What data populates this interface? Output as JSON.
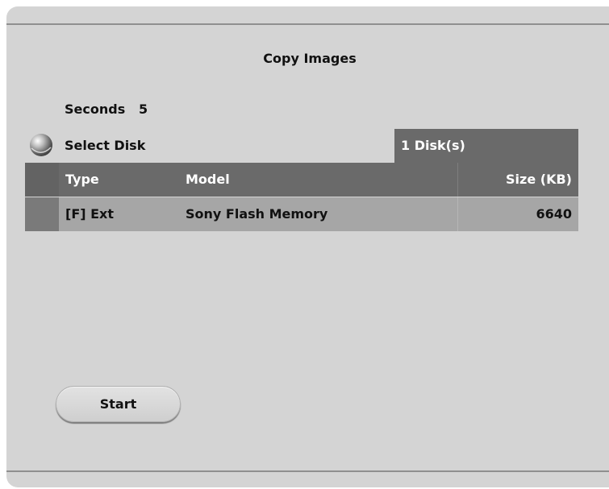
{
  "dialog": {
    "title": "Copy Images"
  },
  "seconds": {
    "label": "Seconds",
    "value": "5"
  },
  "disk_selector": {
    "label": "Select Disk",
    "count_text": "1 Disk(s)"
  },
  "disk_table": {
    "columns": {
      "type": "Type",
      "model": "Model",
      "size": "Size (KB)"
    },
    "rows": [
      {
        "type": "[F] Ext",
        "model": "Sony Flash Memory",
        "size": "6640"
      }
    ]
  },
  "actions": {
    "start_label": "Start"
  },
  "icons": {
    "select_disk": "radio-button-icon"
  },
  "colors": {
    "panel": "#d4d4d4",
    "header_row": "#6a6a6a",
    "data_row": "#a6a6a6"
  }
}
